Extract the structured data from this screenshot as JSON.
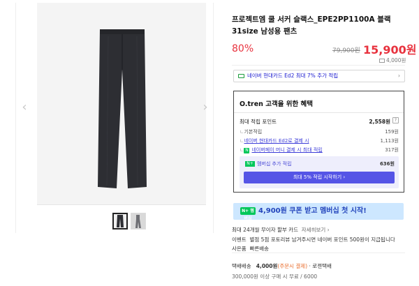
{
  "gallery": {
    "prev_arrow": "‹",
    "next_arrow": "›"
  },
  "product": {
    "title": "프로젝트엠 쿨 서커 슬랙스_EPE2PP1100A 블랙 31size 남성용 팬츠",
    "discount": "80%",
    "original_price": "79,900원",
    "sale_price": "15,900원",
    "shipping_fee": "4,000원"
  },
  "card_banner": {
    "text": "네이버 현대카드 Ed2 최대 7% 추가 적립",
    "chevron": "›"
  },
  "benefit": {
    "title": "O.tren 고객을 위한 혜택",
    "max_points_label": "최대 적립 포인트",
    "max_points_value": "2,558원",
    "help": "?",
    "rows": [
      {
        "label": "기본적립",
        "value": "159원"
      },
      {
        "label": "네이버 현대카드 Ed2로 결제 시",
        "value": "1,113원"
      },
      {
        "label": "네이버페이 머니 결제 시 최대 적립",
        "value": "317원"
      }
    ],
    "member_badge": "N+",
    "member_label": "멤버십 추가 적립",
    "member_value": "636원",
    "member_button": "최대 5% 적립 시작하기 ›"
  },
  "promo": {
    "badge": "N+ 멤버십",
    "text": "4,900원 쿠폰 받고 멤버십 첫 시작!"
  },
  "card_info": {
    "label": "최대 24개월 무이자 할부 카드",
    "link": "자세히보기"
  },
  "event": {
    "label": "이벤트",
    "text": "별점 5점 포토리뷰 남겨주시면 네이버 포인트 500원이 지급됩니다"
  },
  "courier": {
    "label": "사은품",
    "value": "빠른배송"
  },
  "delivery": {
    "label": "택배배송",
    "fee": "4,000원",
    "condition": "(주문시 결제)",
    "carrier": "· 로젠택배",
    "free_condition": "300,000원 이상 구매 시 무료 / 6000"
  }
}
